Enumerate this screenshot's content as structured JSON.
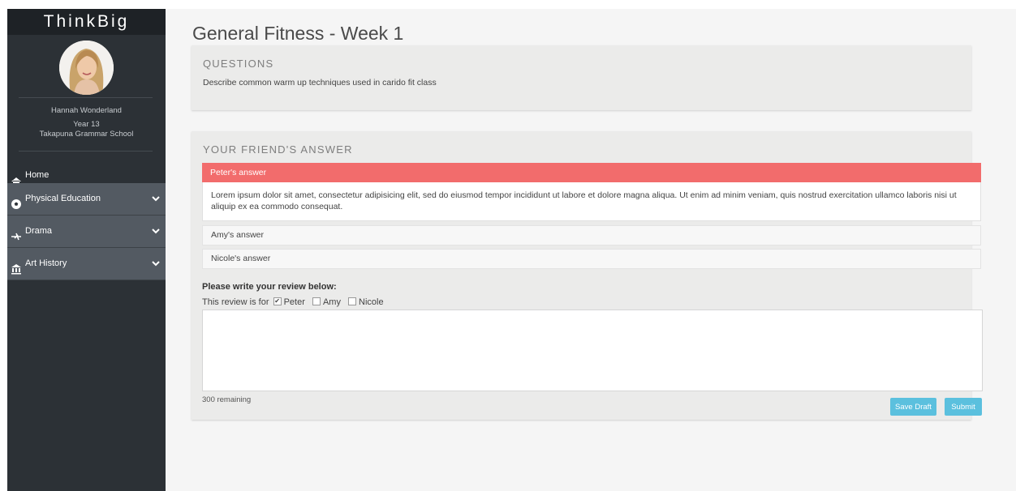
{
  "sidebar": {
    "brand": "ThinkBig",
    "user": {
      "name": "Hannah Wonderland",
      "year": "Year 13",
      "school": "Takapuna Grammar School"
    },
    "nav": [
      {
        "label": "Home",
        "icon": "home-icon"
      },
      {
        "label": "Physical Education",
        "icon": "soccer-ball-icon"
      },
      {
        "label": "Drama",
        "icon": "drama-icon"
      },
      {
        "label": "Art History",
        "icon": "museum-icon"
      }
    ]
  },
  "main": {
    "title": "General Fitness - Week 1",
    "questions": {
      "heading": "QUESTIONS",
      "text": "Describe common warm up techniques used in carido fit class"
    },
    "answers": {
      "heading": "YOUR FRIEND'S ANSWER",
      "items": [
        {
          "label": "Peter's answer",
          "active": true,
          "body": "Lorem ipsum dolor sit amet, consectetur adipisicing elit, sed do eiusmod tempor incididunt ut labore et dolore magna aliqua. Ut enim ad minim veniam, quis nostrud exercitation ullamco laboris nisi ut aliquip ex ea commodo consequat."
        },
        {
          "label": "Amy's answer",
          "active": false
        },
        {
          "label": "Nicole's answer",
          "active": false
        }
      ]
    },
    "review": {
      "label": "Please write your review below:",
      "for_label": "This review is for",
      "recipients": [
        {
          "name": "Peter",
          "checked": true
        },
        {
          "name": "Amy",
          "checked": false
        },
        {
          "name": "Nicole",
          "checked": false
        }
      ],
      "text": "",
      "remaining": "300 remaining",
      "save_label": "Save Draft",
      "submit_label": "Submit"
    }
  },
  "colors": {
    "sidebar_bg": "#2c3136",
    "nav_item_bg": "#535a62",
    "accent_red": "#f26c6c",
    "button_blue": "#5bc0de"
  }
}
